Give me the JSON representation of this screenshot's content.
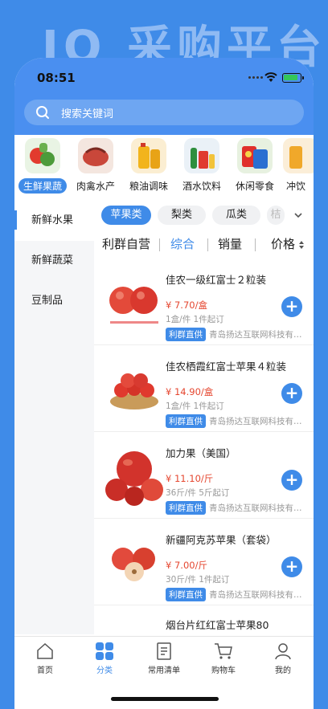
{
  "banner": {
    "title": "IQ 采购平台"
  },
  "status_bar": {
    "time": "08:51"
  },
  "search": {
    "placeholder": "搜索关键词"
  },
  "categories": [
    {
      "label": "生鲜果蔬",
      "active": true
    },
    {
      "label": "肉禽水产",
      "active": false
    },
    {
      "label": "粮油调味",
      "active": false
    },
    {
      "label": "酒水饮料",
      "active": false
    },
    {
      "label": "休闲零食",
      "active": false
    },
    {
      "label": "冲饮",
      "active": false
    }
  ],
  "sidebar": {
    "items": [
      {
        "label": "新鲜水果",
        "active": true
      },
      {
        "label": "新鲜蔬菜",
        "active": false
      },
      {
        "label": "豆制品",
        "active": false
      }
    ]
  },
  "sub_tabs": [
    {
      "label": "苹果类",
      "active": true
    },
    {
      "label": "梨类",
      "active": false
    },
    {
      "label": "瓜类",
      "active": false
    },
    {
      "label": "桔",
      "active": false
    }
  ],
  "sort_bar": {
    "items": [
      {
        "label": "利群自营",
        "active": false
      },
      {
        "label": "综合",
        "active": true
      },
      {
        "label": "销量",
        "active": false
      },
      {
        "label": "价格",
        "active": false
      }
    ]
  },
  "products": [
    {
      "name": "佳农一级红富士２粒装",
      "price": "¥ 7.70/盒",
      "spec": "1盒/件  1件起订",
      "tag": "利群直供",
      "supplier": "青岛扬达互联网科技有限公司"
    },
    {
      "name": "佳农栖霞红富士苹果４粒装",
      "price": "¥ 14.90/盒",
      "spec": "1盒/件  1件起订",
      "tag": "利群直供",
      "supplier": "青岛扬达互联网科技有限公司"
    },
    {
      "name": "加力果（美国）",
      "price": "¥ 11.10/斤",
      "spec": "36斤/件  5斤起订",
      "tag": "利群直供",
      "supplier": "青岛扬达互联网科技有限公司"
    },
    {
      "name": "新疆阿克苏苹果（套袋）",
      "price": "¥ 7.00/斤",
      "spec": "30斤/件  1件起订",
      "tag": "利群直供",
      "supplier": "青岛扬达互联网科技有限公司"
    },
    {
      "name": "烟台片红红富士苹果80",
      "price": "",
      "spec": "",
      "tag": "",
      "supplier": ""
    }
  ],
  "tabbar": [
    {
      "label": "首页",
      "icon": "home-icon",
      "active": false
    },
    {
      "label": "分类",
      "icon": "category-grid-icon",
      "active": true
    },
    {
      "label": "常用清单",
      "icon": "list-icon",
      "active": false
    },
    {
      "label": "购物车",
      "icon": "cart-icon",
      "active": false
    },
    {
      "label": "我的",
      "icon": "user-icon",
      "active": false
    }
  ],
  "colors": {
    "accent": "#3f8be8",
    "price": "#e5462f"
  }
}
